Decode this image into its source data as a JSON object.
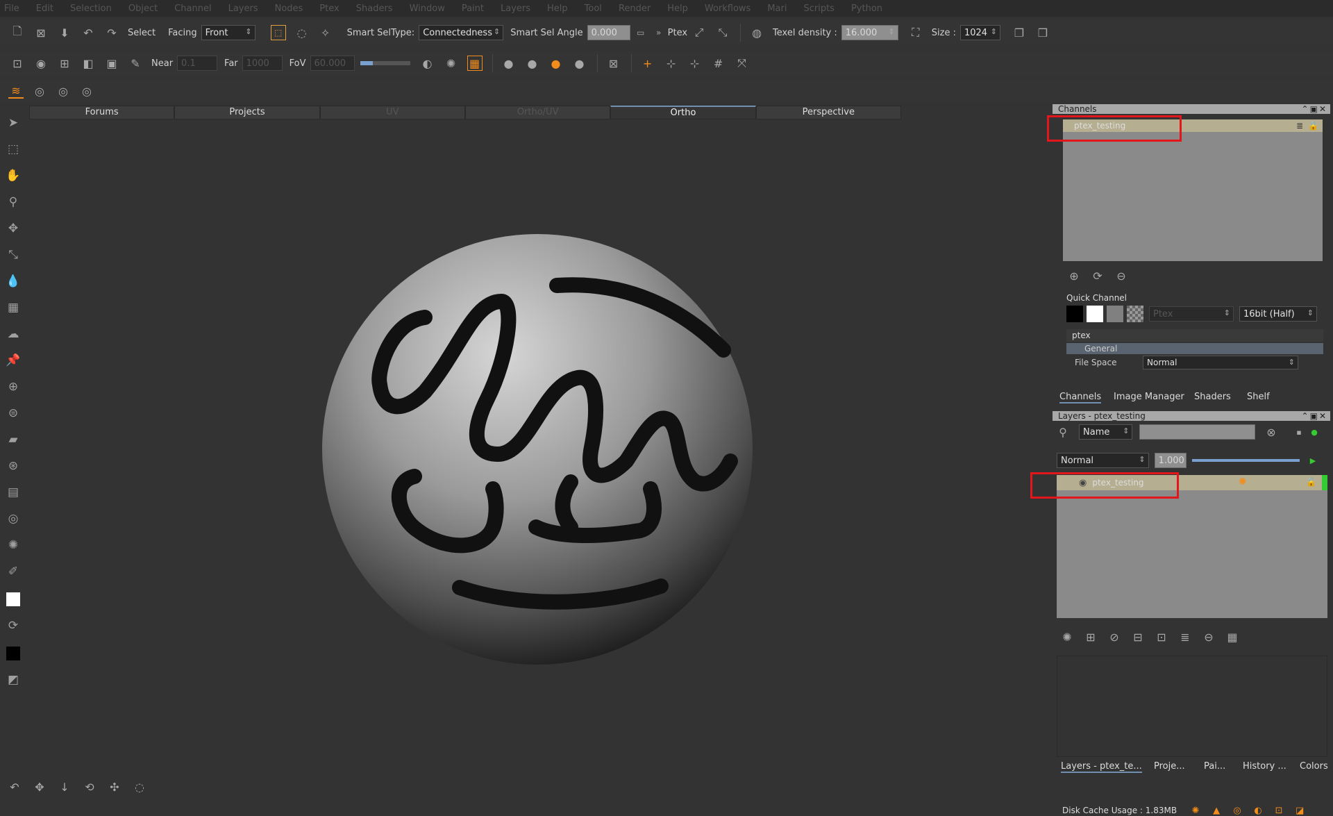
{
  "menu": [
    "File",
    "Edit",
    "Selection",
    "Object",
    "Channel",
    "Layers",
    "Nodes",
    "Ptex",
    "Shaders",
    "Window",
    "Paint",
    "Layers",
    "Help",
    "Tool",
    "Render",
    "Help",
    "Workflows",
    "Mari",
    "Scripts",
    "Python"
  ],
  "toolbar1": {
    "select_label": "Select",
    "facing_label": "Facing",
    "facing_value": "Front",
    "smart_sel_type_label": "Smart SelType:",
    "smart_sel_type_value": "Connectedness",
    "smart_sel_angle_label": "Smart Sel Angle",
    "smart_sel_angle_value": "0.000",
    "ptex_label": "Ptex",
    "texel_density_label": "Texel density :",
    "texel_density_value": "16.000",
    "size_label": "Size :",
    "size_value": "1024"
  },
  "toolbar2": {
    "near_label": "Near",
    "near_value": "0.1",
    "far_label": "Far",
    "far_value": "1000",
    "fov_label": "FoV",
    "fov_value": "60.000"
  },
  "view_tabs": [
    {
      "label": "Forums",
      "state": "normal"
    },
    {
      "label": "Projects",
      "state": "normal"
    },
    {
      "label": "UV",
      "state": "disabled"
    },
    {
      "label": "Ortho/UV",
      "state": "disabled"
    },
    {
      "label": "Ortho",
      "state": "active"
    },
    {
      "label": "Perspective",
      "state": "normal"
    }
  ],
  "channels_panel": {
    "title": "Channels",
    "channel_name": "ptex_testing",
    "quick_channel_label": "Quick Channel",
    "quick_channel_name": "Ptex",
    "bit_depth": "16bit (Half)",
    "tree_root": "ptex",
    "tree_group": "General",
    "file_space_label": "File Space",
    "file_space_value": "Normal"
  },
  "mid_tabs": [
    "Channels",
    "Image Manager",
    "Shaders",
    "Shelf"
  ],
  "layers_panel": {
    "title": "Layers - ptex_testing",
    "filter_label": "Name",
    "blend_mode": "Normal",
    "opacity": "1.000",
    "layer_name": "ptex_testing"
  },
  "bottom_tabs": [
    "Layers - ptex_te...",
    "Proje...",
    "Pai...",
    "History ...",
    "Colors"
  ],
  "status": {
    "disk_cache": "Disk Cache Usage : 1.83MB"
  },
  "colors": {
    "accent": "#f28c1a",
    "highlight_box": "#e3161b",
    "layer_green": "#33cc33"
  }
}
